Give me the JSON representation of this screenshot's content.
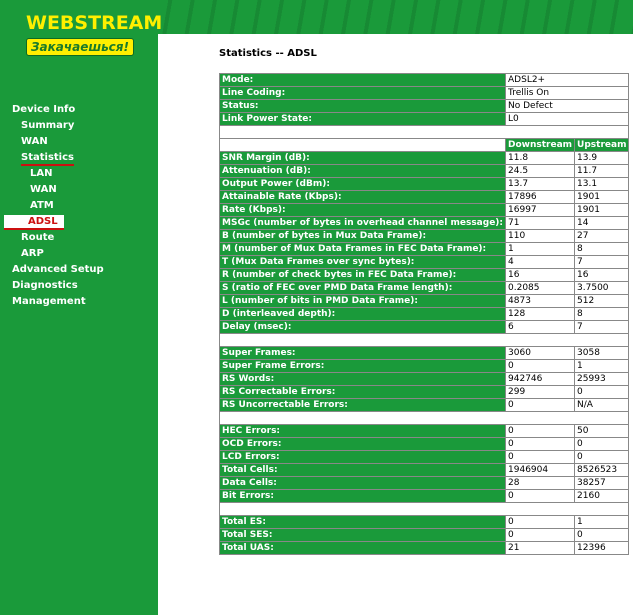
{
  "brand": {
    "title": "WEBSTREAM",
    "tagline": "Закачаешься!"
  },
  "menu": {
    "device_info": "Device Info",
    "summary": "Summary",
    "wan": "WAN",
    "statistics": "Statistics",
    "lan": "LAN",
    "stat_wan": "WAN",
    "atm": "ATM",
    "adsl": "ADSL",
    "route": "Route",
    "arp": "ARP",
    "advanced_setup": "Advanced Setup",
    "diagnostics": "Diagnostics",
    "management": "Management"
  },
  "page": {
    "title": "Statistics -- ADSL"
  },
  "info": [
    {
      "label": "Mode:",
      "value": "ADSL2+"
    },
    {
      "label": "Line Coding:",
      "value": "Trellis On"
    },
    {
      "label": "Status:",
      "value": "No Defect"
    },
    {
      "label": "Link Power State:",
      "value": "L0"
    }
  ],
  "columns": {
    "downstream": "Downstream",
    "upstream": "Upstream"
  },
  "line_stats": [
    {
      "label": "SNR Margin (dB):",
      "down": "11.8",
      "up": "13.9"
    },
    {
      "label": "Attenuation (dB):",
      "down": "24.5",
      "up": "11.7"
    },
    {
      "label": "Output Power (dBm):",
      "down": "13.7",
      "up": "13.1"
    },
    {
      "label": "Attainable Rate (Kbps):",
      "down": "17896",
      "up": "1901"
    },
    {
      "label": "Rate (Kbps):",
      "down": "16997",
      "up": "1901"
    },
    {
      "label": "MSGc (number of bytes in overhead channel message):",
      "down": "71",
      "up": "14"
    },
    {
      "label": "B (number of bytes in Mux Data Frame):",
      "down": "110",
      "up": "27"
    },
    {
      "label": "M (number of Mux Data Frames in FEC Data Frame):",
      "down": "1",
      "up": "8"
    },
    {
      "label": "T (Mux Data Frames over sync bytes):",
      "down": "4",
      "up": "7"
    },
    {
      "label": "R (number of check bytes in FEC Data Frame):",
      "down": "16",
      "up": "16"
    },
    {
      "label": "S (ratio of FEC over PMD Data Frame length):",
      "down": "0.2085",
      "up": "3.7500"
    },
    {
      "label": "L (number of bits in PMD Data Frame):",
      "down": "4873",
      "up": "512"
    },
    {
      "label": "D (interleaved depth):",
      "down": "128",
      "up": "8"
    },
    {
      "label": "Delay (msec):",
      "down": "6",
      "up": "7"
    }
  ],
  "frame_stats": [
    {
      "label": "Super Frames:",
      "down": "3060",
      "up": "3058"
    },
    {
      "label": "Super Frame Errors:",
      "down": "0",
      "up": "1"
    },
    {
      "label": "RS Words:",
      "down": "942746",
      "up": "25993"
    },
    {
      "label": "RS Correctable Errors:",
      "down": "299",
      "up": "0"
    },
    {
      "label": "RS Uncorrectable Errors:",
      "down": "0",
      "up": "N/A"
    }
  ],
  "cell_stats": [
    {
      "label": "HEC Errors:",
      "down": "0",
      "up": "50"
    },
    {
      "label": "OCD Errors:",
      "down": "0",
      "up": "0"
    },
    {
      "label": "LCD Errors:",
      "down": "0",
      "up": "0"
    },
    {
      "label": "Total Cells:",
      "down": "1946904",
      "up": "8526523"
    },
    {
      "label": "Data Cells:",
      "down": "28",
      "up": "38257"
    },
    {
      "label": "Bit Errors:",
      "down": "0",
      "up": "2160"
    }
  ],
  "error_seconds": [
    {
      "label": "Total ES:",
      "down": "0",
      "up": "1"
    },
    {
      "label": "Total SES:",
      "down": "0",
      "up": "0"
    },
    {
      "label": "Total UAS:",
      "down": "21",
      "up": "12396"
    }
  ]
}
